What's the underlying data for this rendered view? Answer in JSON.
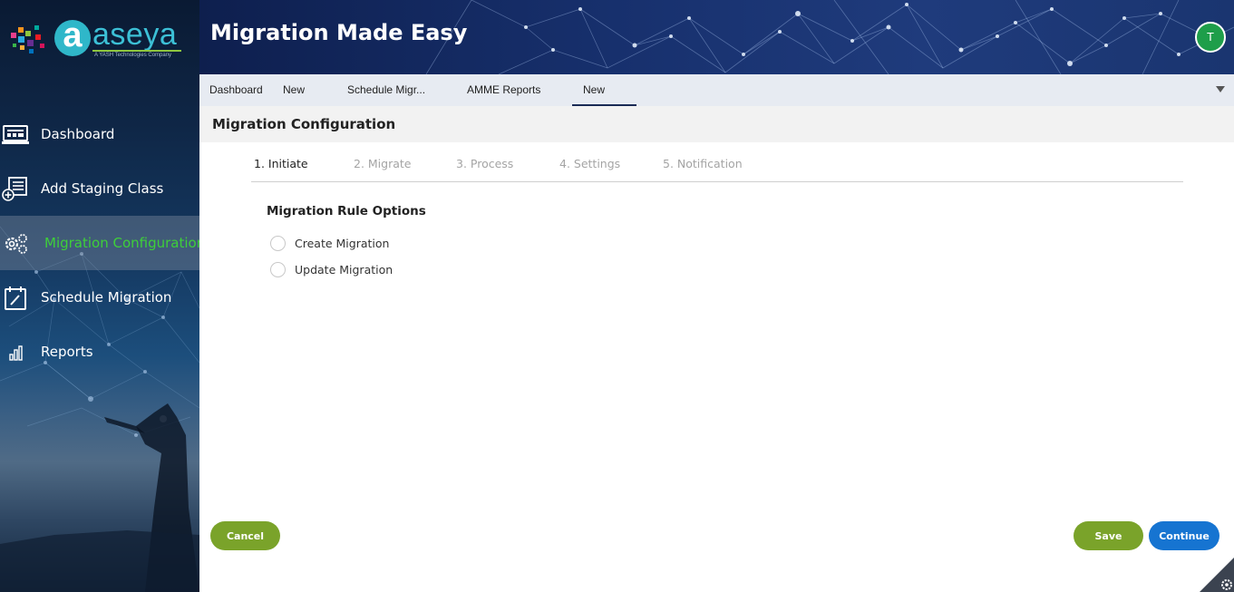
{
  "brand": {
    "logo_letter": "a",
    "logo_word": "aseya",
    "tagline": "A YASH Technologies Company",
    "colors": {
      "cyan": "#3cc0d6",
      "green": "#8ec63f"
    }
  },
  "header": {
    "title": "Migration Made Easy",
    "avatar_initial": "T",
    "avatar_color": "#1e9e4a"
  },
  "sidebar": {
    "items": [
      {
        "label": "Dashboard",
        "icon": "monitor-icon",
        "active": false
      },
      {
        "label": "Add Staging Class",
        "icon": "add-list-icon",
        "active": false
      },
      {
        "label": "Migration Configuration",
        "icon": "gears-icon",
        "active": true
      },
      {
        "label": "Schedule Migration",
        "icon": "calendar-edit-icon",
        "active": false
      },
      {
        "label": "Reports",
        "icon": "bar-chart-icon",
        "active": false
      }
    ],
    "active_color": "#3ecf3a"
  },
  "tabs": {
    "items": [
      {
        "label": "Dashboard",
        "active": false
      },
      {
        "label": "New",
        "active": false
      },
      {
        "label": "Schedule Migr...",
        "active": false
      },
      {
        "label": "AMME Reports",
        "active": false
      },
      {
        "label": "New",
        "active": true
      }
    ],
    "dropdown_icon": "triangle-down-icon"
  },
  "page": {
    "title": "Migration Configuration"
  },
  "steps": [
    {
      "label": "1. Initiate",
      "current": true
    },
    {
      "label": "2. Migrate",
      "current": false
    },
    {
      "label": "3. Process",
      "current": false
    },
    {
      "label": "4. Settings",
      "current": false
    },
    {
      "label": "5. Notification",
      "current": false
    }
  ],
  "rule_options": {
    "title": "Migration Rule Options",
    "options": [
      {
        "label": "Create Migration",
        "selected": false
      },
      {
        "label": "Update Migration",
        "selected": false
      }
    ]
  },
  "buttons": {
    "cancel": "Cancel",
    "save": "Save",
    "continue": "Continue",
    "green": "#7aa32a",
    "blue": "#1674d1"
  }
}
